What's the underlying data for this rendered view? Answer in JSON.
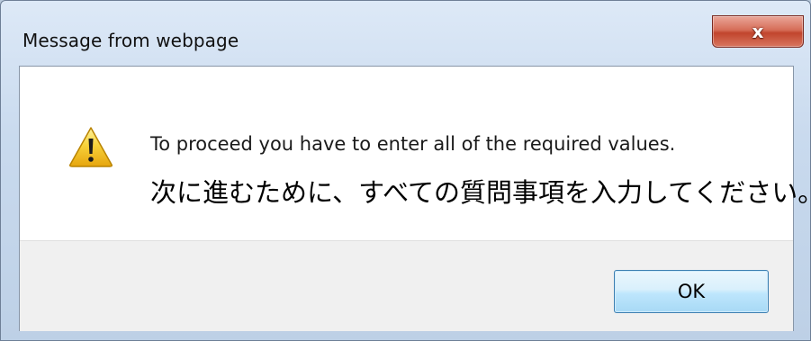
{
  "dialog": {
    "title": "Message from webpage",
    "close_glyph": "x",
    "icon": "warning-icon",
    "message_en": "To proceed you have to enter all of the required values.",
    "message_ja": "次に進むために、すべての質問事項を入力してください。",
    "ok_label": "OK"
  },
  "colors": {
    "frame": "#c9daee",
    "close_button": "#c1452d",
    "ok_border": "#3c7fb1",
    "warning_yellow": "#f7c51c"
  }
}
